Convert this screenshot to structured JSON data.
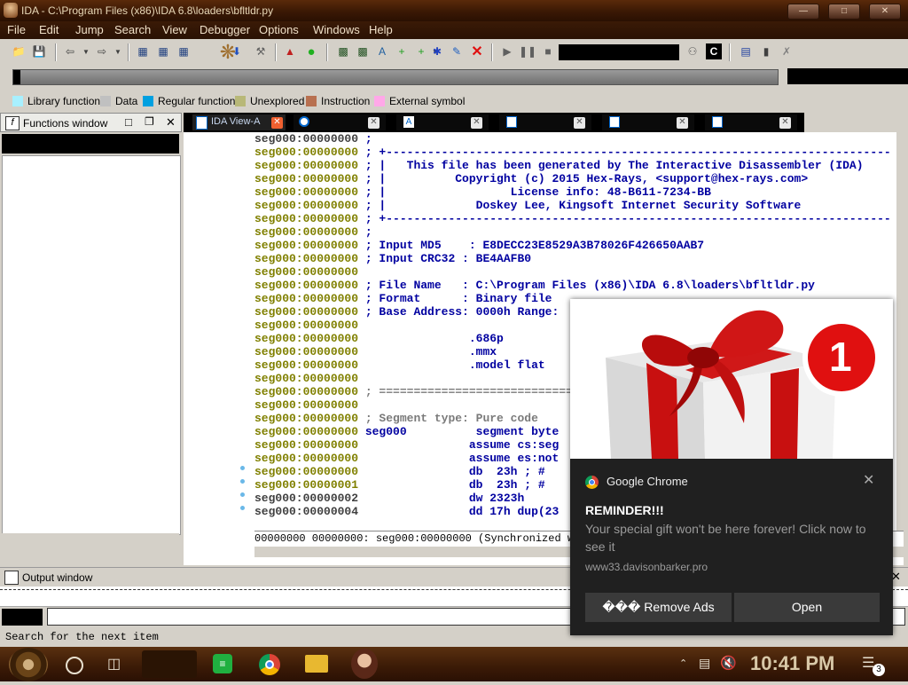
{
  "window": {
    "title": "IDA - C:\\Program Files (x86)\\IDA 6.8\\loaders\\bfltldr.py"
  },
  "menu": [
    "File",
    "Edit",
    "Jump",
    "Search",
    "View",
    "Debugger",
    "Options",
    "Windows",
    "Help"
  ],
  "legend": [
    {
      "label": "Library function",
      "color": "#a8f0ff"
    },
    {
      "label": "Data",
      "color": "#c0c0c0"
    },
    {
      "label": "Regular function",
      "color": "#00a0e0"
    },
    {
      "label": "Unexplored",
      "color": "#b8b878"
    },
    {
      "label": "Instruction",
      "color": "#b87050"
    },
    {
      "label": "External symbol",
      "color": "#ffa8e8"
    }
  ],
  "functions_window": {
    "title": "Functions window"
  },
  "tabs": [
    {
      "label": "IDA View-A"
    },
    {
      "label": ""
    },
    {
      "label": ""
    },
    {
      "label": ""
    },
    {
      "label": ""
    },
    {
      "label": ""
    }
  ],
  "code_lines": [
    {
      "addr": "seg000:00000000",
      "text": " ;",
      "cls": "cm",
      "a0": true
    },
    {
      "addr": "seg000:00000000",
      "text": " ; +-------------------------------------------------------------------------",
      "cls": "cm"
    },
    {
      "addr": "seg000:00000000",
      "text": " ; |   This file has been generated by The Interactive Disassembler (IDA)",
      "cls": "cm"
    },
    {
      "addr": "seg000:00000000",
      "text": " ; |          Copyright (c) 2015 Hex-Rays, <support@hex-rays.com>",
      "cls": "cm"
    },
    {
      "addr": "seg000:00000000",
      "text": " ; |                  License info: 48-B611-7234-BB",
      "cls": "cm"
    },
    {
      "addr": "seg000:00000000",
      "text": " ; |             Doskey Lee, Kingsoft Internet Security Software",
      "cls": "cm"
    },
    {
      "addr": "seg000:00000000",
      "text": " ; +-------------------------------------------------------------------------",
      "cls": "cm"
    },
    {
      "addr": "seg000:00000000",
      "text": " ;",
      "cls": "cm"
    },
    {
      "addr": "seg000:00000000",
      "text": " ; Input MD5    : E8DECC23E8529A3B78026F426650AAB7",
      "cls": "cm"
    },
    {
      "addr": "seg000:00000000",
      "text": " ; Input CRC32 : BE4AAFB0",
      "cls": "cm"
    },
    {
      "addr": "seg000:00000000",
      "text": "",
      "cls": "cm"
    },
    {
      "addr": "seg000:00000000",
      "text": " ; File Name   : C:\\Program Files (x86)\\IDA 6.8\\loaders\\bfltldr.py",
      "cls": "cm"
    },
    {
      "addr": "seg000:00000000",
      "text": " ; Format      : Binary file",
      "cls": "cm"
    },
    {
      "addr": "seg000:00000000",
      "text": " ; Base Address: 0000h Range:",
      "cls": "cm"
    },
    {
      "addr": "seg000:00000000",
      "text": "",
      "cls": "cm"
    },
    {
      "addr": "seg000:00000000",
      "text": "                .686p",
      "cls": "kw"
    },
    {
      "addr": "seg000:00000000",
      "text": "                .mmx",
      "cls": "kw"
    },
    {
      "addr": "seg000:00000000",
      "text": "                .model flat",
      "cls": "kw"
    },
    {
      "addr": "seg000:00000000",
      "text": "",
      "cls": "cm"
    },
    {
      "addr": "seg000:00000000",
      "text": " ; ==========================================================================",
      "cls": "gr"
    },
    {
      "addr": "seg000:00000000",
      "text": "",
      "cls": "cm"
    },
    {
      "addr": "seg000:00000000",
      "text": " ; Segment type: Pure code",
      "cls": "gr"
    },
    {
      "addr": "seg000:00000000",
      "text": " seg000          segment byte",
      "cls": "kw"
    },
    {
      "addr": "seg000:00000000",
      "text": "                assume cs:seg",
      "cls": "kw"
    },
    {
      "addr": "seg000:00000000",
      "text": "                assume es:not",
      "cls": "kw"
    },
    {
      "addr": "seg000:00000000",
      "text": "                db  23h ; #",
      "cls": "kw"
    },
    {
      "addr": "seg000:00000001",
      "text": "                db  23h ; #",
      "cls": "kw"
    },
    {
      "addr": "seg000:00000002",
      "text": "                dw 2323h",
      "cls": "kw",
      "a0": true
    },
    {
      "addr": "seg000:00000004",
      "text": "                dd 17h dup(23",
      "cls": "kw",
      "a0": true
    }
  ],
  "sync_status": "00000000 00000000: seg000:00000000 (Synchronized wi",
  "output_window": {
    "title": "Output window"
  },
  "status_hint": "Search for the next item",
  "taskbar": {
    "time": "10:41 PM",
    "notif_count": "3"
  },
  "notification": {
    "app": "Google Chrome",
    "badge": "1",
    "title": "REMINDER!!!",
    "message": "Your special gift won't be here forever! Click now to see it",
    "site": "www33.davisonbarker.pro",
    "btn_remove": "��� Remove Ads",
    "btn_open": "Open"
  }
}
